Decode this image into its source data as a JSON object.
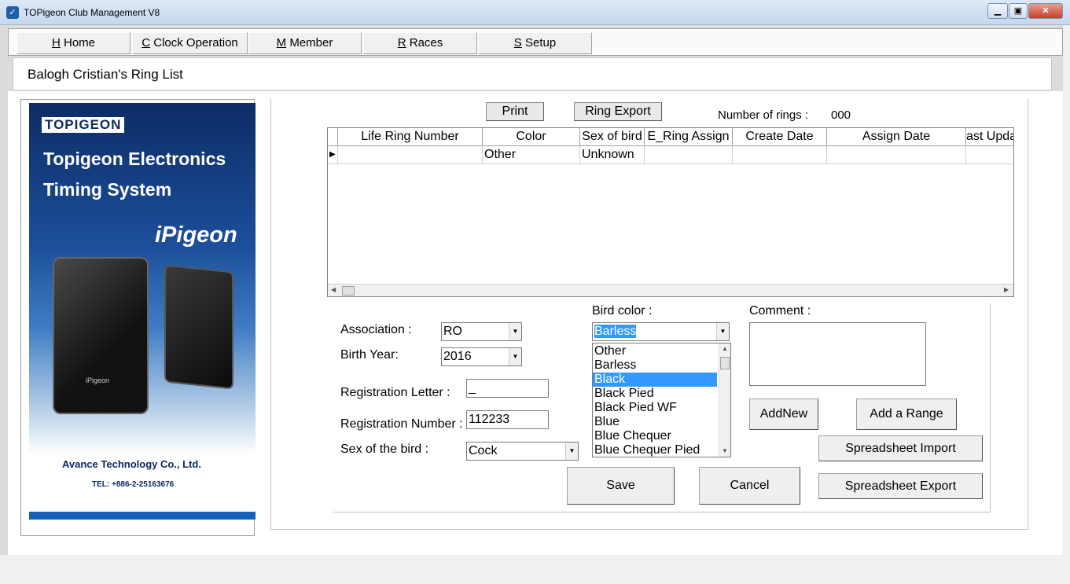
{
  "window": {
    "title": "TOPigeon Club Management V8",
    "controls": [
      "minimize-icon",
      "maximize-icon",
      "close-icon"
    ]
  },
  "menu": [
    {
      "key": "H",
      "label": " Home"
    },
    {
      "key": "C",
      "label": " Clock Operation"
    },
    {
      "key": "M",
      "label": " Member"
    },
    {
      "key": "R",
      "label": " Races"
    },
    {
      "key": "S",
      "label": " Setup"
    }
  ],
  "page": {
    "heading": "Balogh Cristian's Ring List"
  },
  "banner": {
    "logo": "TOPIGEON",
    "line1": "Topigeon Electronics",
    "line2": "Timing System",
    "product": "iPigeon",
    "device_label": "iPigeon",
    "company": "Avance Technology Co., Ltd.",
    "tel": "TEL: +886-2-25163676"
  },
  "toolbar": {
    "print": "Print",
    "ring_export": "Ring Export",
    "num_rings_label": "Number of rings :",
    "num_rings_value": "000"
  },
  "grid": {
    "columns": [
      "Life Ring Number",
      "Color",
      "Sex of bird",
      "E_Ring Assign",
      "Create Date",
      "Assign Date",
      "ast Upda"
    ],
    "rows": [
      [
        "",
        "Other",
        "Unknown",
        "",
        "",
        "",
        ""
      ]
    ]
  },
  "form": {
    "association_label": "Association :",
    "association_value": "RO",
    "birth_year_label": "Birth Year:",
    "birth_year_value": "2016",
    "reg_letter_label": "Registration Letter :",
    "reg_letter_value": "_",
    "reg_number_label": "Registration Number :",
    "reg_number_value": "112233",
    "sex_label": "Sex of the bird :",
    "sex_value": "Cock",
    "bird_color_label": "Bird color :",
    "bird_color_value": "Barless",
    "bird_color_options": [
      "Other",
      "Barless",
      "Black",
      "Black Pied",
      "Black Pied WF",
      "Blue",
      "Blue Chequer",
      "Blue Chequer Pied"
    ],
    "bird_color_highlighted": "Black",
    "comment_label": "Comment :",
    "comment_value": ""
  },
  "actions": {
    "add_new": "AddNew",
    "add_range": "Add a Range",
    "spreadsheet_import": "Spreadsheet Import",
    "save": "Save",
    "cancel": "Cancel",
    "spreadsheet_export": "Spreadsheet Export"
  },
  "colors": {
    "selection": "#3399ff",
    "banner_blue": "#1462b8"
  }
}
